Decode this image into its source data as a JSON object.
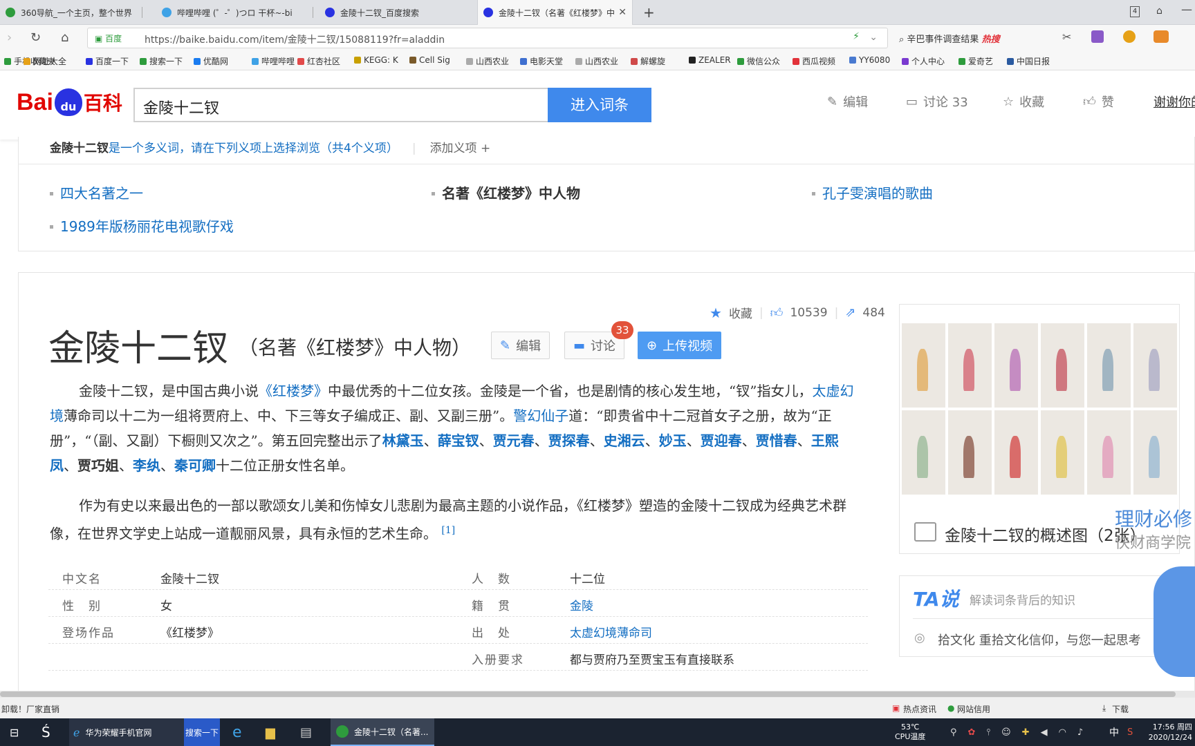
{
  "tabs": [
    {
      "title": "360导航_一个主页，整个世界",
      "fav": "#2e9c3d"
    },
    {
      "title": "哔哩哔哩 (゜-゜)つロ 干杯~-bil",
      "fav": "#3fa2e6"
    },
    {
      "title": "金陵十二钗_百度搜索",
      "fav": "#2932e1"
    },
    {
      "title": "金陵十二钗（名著《红楼梦》中",
      "fav": "#2932e1"
    }
  ],
  "tab_count": "4",
  "url": {
    "site": "百度",
    "text": "https://baike.baidu.com/item/金陵十二钗/15088119?fr=aladdin"
  },
  "hot_search": {
    "text": "辛巴事件调查结果",
    "badge": "热搜"
  },
  "bookmarks": [
    {
      "label": "手机收藏夹",
      "c": "#2e9c3d"
    },
    {
      "label": "网址大全",
      "c": "#e6a117"
    },
    {
      "label": "百度一下",
      "c": "#2932e1"
    },
    {
      "label": "搜索一下",
      "c": "#2e9c3d"
    },
    {
      "label": "优酷网",
      "c": "#1a7cf0"
    },
    {
      "label": "哔哩哔哩",
      "c": "#3fa2e6"
    },
    {
      "label": "红杏社区",
      "c": "#e24a4a"
    },
    {
      "label": "KEGG: K",
      "c": "#c8a000"
    },
    {
      "label": "Cell Sig",
      "c": "#7a5a2a"
    },
    {
      "label": "山西农业",
      "c": "#aaaaaa"
    },
    {
      "label": "电影天堂",
      "c": "#3f6fd0"
    },
    {
      "label": "山西农业",
      "c": "#aaaaaa"
    },
    {
      "label": "解螺旋",
      "c": "#d04a4a"
    },
    {
      "label": "ZEALER",
      "c": "#222222"
    },
    {
      "label": "微信公众",
      "c": "#2e9c3d"
    },
    {
      "label": "西瓜视频",
      "c": "#e2323a"
    },
    {
      "label": "YY6080",
      "c": "#4a7ad0"
    },
    {
      "label": "个人中心",
      "c": "#7a3ad0"
    },
    {
      "label": "爱奇艺",
      "c": "#2e9c3d"
    },
    {
      "label": "中国日报",
      "c": "#2a5aa0"
    }
  ],
  "logo": {
    "bai": "Bai",
    "du": "du",
    "baike": "百科"
  },
  "search": {
    "value": "金陵十二钗",
    "button": "进入词条"
  },
  "header_actions": {
    "edit": "编辑",
    "discuss": "讨论 33",
    "favorite": "收藏",
    "like": "赞",
    "thanks": "谢谢你的"
  },
  "polysemy": {
    "term": "金陵十二钗",
    "text": "是一个多义词，请在下列义项上选择浏览（共4个义项）",
    "add": "添加义项 +",
    "items": [
      "四大名著之一",
      "名著《红楼梦》中人物",
      "孔子雯演唱的歌曲",
      "1989年版杨丽花电视歌仔戏"
    ]
  },
  "entry": {
    "title": "金陵十二钗",
    "subtitle": "（名著《红楼梦》中人物）",
    "edit": "编辑",
    "discuss": "讨论",
    "discuss_badge": "33",
    "upload": "上传视频",
    "stats": {
      "favorite": "收藏",
      "likes": "10539",
      "shares": "484"
    },
    "para1": {
      "p1": "金陵十二钗，是中国古典小说",
      "l1": "《红楼梦》",
      "p2": "中最优秀的十二位女孩。金陵是一个省，也是剧情的核心发生地，“钗”指女儿，",
      "l2": "太虚幻境",
      "p3": "薄命司以十二为一组将贾府上、中、下三等女子编成正、副、又副三册”。",
      "l3": "警幻仙子",
      "p4": "道：“即贵省中十二冠首女子之册，故为“正册”，“（副、又副）下橱则又次之”。第五回完整出示了",
      "names": [
        "林黛玉",
        "薛宝钗",
        "贾元春",
        "贾探春",
        "史湘云",
        "妙玉",
        "贾迎春",
        "贾惜春",
        "王熙凤"
      ],
      "plain1": "贾巧姐",
      "names2": [
        "李纨",
        "秦可卿"
      ],
      "p5": "十二位正册女性名单。",
      "sep": "、"
    },
    "para2": {
      "text": "作为有史以来最出色的一部以歌颂女儿美和伤悼女儿悲剧为最高主题的小说作品，《红楼梦》塑造的金陵十二钗成为经典艺术群像，在世界文学史上站成一道靓丽风景，具有永恒的艺术生命。",
      "ref": "[1]"
    },
    "info": [
      {
        "k1": "中文名",
        "v1": "金陵十二钗",
        "k2": "人　数",
        "v2": "十二位"
      },
      {
        "k1": "性　别",
        "v1": "女",
        "k2": "籍　贯",
        "v2": "金陵"
      },
      {
        "k1": "登场作品",
        "v1": "《红楼梦》",
        "k2": "出　处",
        "v2": "太虚幻境薄命司"
      },
      {
        "k1": "",
        "v1": "",
        "k2": "入册要求",
        "v2": "都与贾府乃至贾宝玉有直接联系"
      }
    ]
  },
  "album": {
    "caption": "金陵十二钗的概述图（2张）",
    "ad1": "理财必修",
    "ad2": "快财商学院",
    "colors": [
      "#e0a040",
      "#d04a5a",
      "#b05ab0",
      "#c03a4a",
      "#7a9ab0",
      "#a0a0c0",
      "#8ab08a",
      "#7a3a2a",
      "#d02a2a",
      "#e0c040",
      "#e08ab0",
      "#8ab0d0"
    ]
  },
  "ta": {
    "logo": "TA说",
    "desc": "解读词条背后的知识",
    "item": "拾文化  重拾文化信仰，与您一起思考"
  },
  "statusbar": {
    "left": "卸载！厂家直销",
    "items": [
      "热点资讯",
      "网站信用",
      "下载"
    ]
  },
  "taskbar": {
    "app1": "华为荣耀手机官网",
    "search": "搜索一下",
    "active": "金陵十二钗（名著...",
    "temp": "53℃",
    "temp_label": "CPU温度",
    "ime": "中",
    "time": "17:56 周四",
    "date": "2020/12/24"
  }
}
